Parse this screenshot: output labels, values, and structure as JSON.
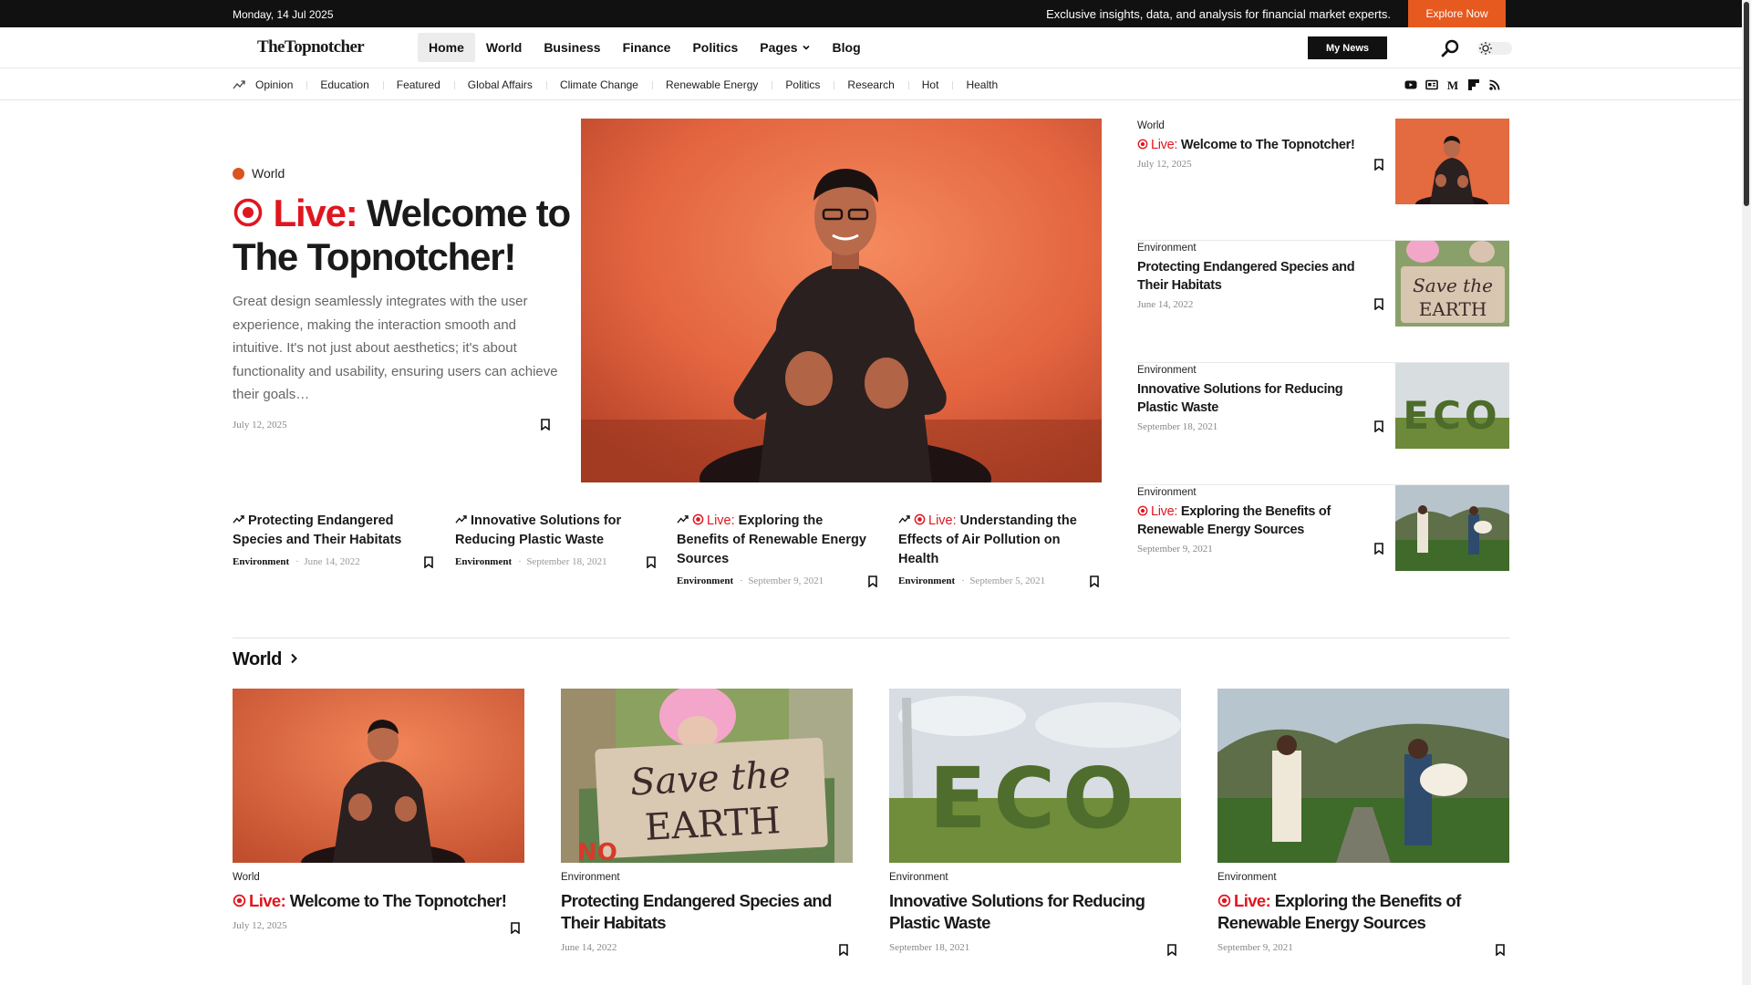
{
  "topbar": {
    "date": "Monday, 14 Jul 2025",
    "promo": "Exclusive insights, data, and analysis for financial market experts.",
    "explore_label": "Explore Now"
  },
  "header": {
    "logo": "TheTopnotcher",
    "nav": [
      "Home",
      "World",
      "Business",
      "Finance",
      "Politics",
      "Pages",
      "Blog"
    ],
    "mynews_label": "My News"
  },
  "subnav": {
    "items": [
      "Opinion",
      "Education",
      "Featured",
      "Global Affairs",
      "Climate Change",
      "Renewable Energy",
      "Politics",
      "Research",
      "Hot",
      "Health"
    ],
    "socials": [
      "youtube-icon",
      "news-icon",
      "medium-icon",
      "flipboard-icon",
      "rss-icon"
    ]
  },
  "hero": {
    "category": "World",
    "live_label": "Live:",
    "title": "Welcome to The Topnotcher!",
    "excerpt": "Great design seamlessly integrates with the user experience, making the interaction smooth and intuitive. It's not just about aesthetics; it's about functionality and usability, ensuring users can achieve their goals…",
    "date": "July 12, 2025"
  },
  "mini_posts": [
    {
      "live": "",
      "title": "Protecting Endangered Species and Their Habitats",
      "category": "Environment",
      "date": "June 14, 2022"
    },
    {
      "live": "",
      "title": "Innovative Solutions for Reducing Plastic Waste",
      "category": "Environment",
      "date": "September 18, 2021"
    },
    {
      "live": "Live:",
      "title": "Exploring the Benefits of Renewable Energy Sources",
      "category": "Environment",
      "date": "September 9, 2021"
    },
    {
      "live": "Live:",
      "title": "Understanding the Effects of Air Pollution on Health",
      "category": "Environment",
      "date": "September 5, 2021"
    }
  ],
  "side_posts": [
    {
      "category": "World",
      "live": "Live:",
      "title": "Welcome to The Topnotcher!",
      "date": "July 12, 2025"
    },
    {
      "category": "Environment",
      "live": "",
      "title": "Protecting Endangered Species and Their Habitats",
      "date": "June 14, 2022"
    },
    {
      "category": "Environment",
      "live": "",
      "title": "Innovative Solutions for Reducing Plastic Waste",
      "date": "September 18, 2021"
    },
    {
      "category": "Environment",
      "live": "Live:",
      "title": "Exploring the Benefits of Renewable Energy Sources",
      "date": "September 9, 2021"
    }
  ],
  "world": {
    "heading": "World",
    "cards": [
      {
        "category": "World",
        "live": "Live:",
        "title": "Welcome to The Topnotcher!",
        "date": "July 12, 2025"
      },
      {
        "category": "Environment",
        "live": "",
        "title": "Protecting Endangered Species and Their Habitats",
        "date": "June 14, 2022"
      },
      {
        "category": "Environment",
        "live": "",
        "title": "Innovative Solutions for Reducing Plastic Waste",
        "date": "September 18, 2021"
      },
      {
        "category": "Environment",
        "live": "Live:",
        "title": "Exploring the Benefits of Renewable Energy Sources",
        "date": "September 9, 2021"
      }
    ]
  },
  "images": {
    "save_sign_text": "Save the EARTH",
    "eco_text": "ECO",
    "no_text": "NO"
  },
  "colors": {
    "accent": "#e65a1f",
    "live": "#e0161f",
    "category_dot": "#d9541e"
  }
}
